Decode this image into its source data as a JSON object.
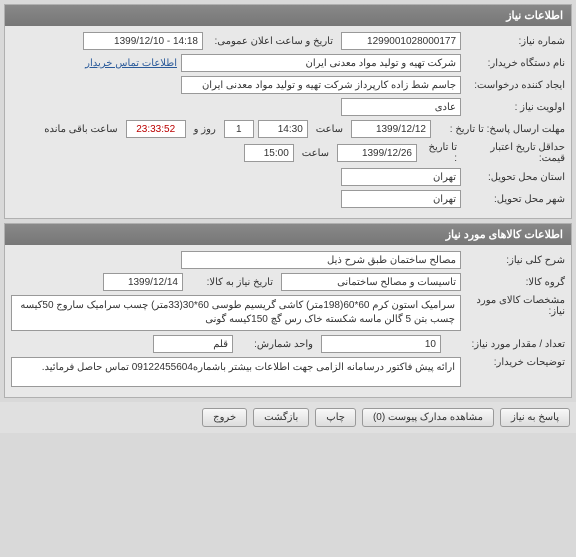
{
  "panel1": {
    "title": "اطلاعات نیاز",
    "need_no_label": "شماره نیاز:",
    "need_no": "1299001028000177",
    "announce_label": "تاریخ و ساعت اعلان عمومی:",
    "announce": "14:18 - 1399/12/10",
    "buyer_label": "نام دستگاه خریدار:",
    "buyer": "شرکت تهیه و تولید مواد معدنی ایران",
    "contact_link": "اطلاعات تماس خریدار",
    "requester_label": "ایجاد کننده درخواست:",
    "requester": "جاسم شط زاده کارپرداز شرکت تهیه و تولید مواد معدنی ایران",
    "priority_label": "اولویت نیاز :",
    "priority": "عادی",
    "deadline_label": "مهلت ارسال پاسخ:  تا تاریخ :",
    "deadline_date": "1399/12/12",
    "time_label": "ساعت",
    "deadline_time": "14:30",
    "days": "1",
    "days_label": "روز و",
    "countdown": "23:33:52",
    "remaining": "ساعت باقی مانده",
    "valid_label": "حداقل تاریخ اعتبار قیمت:",
    "to_date_label": "تا تاریخ :",
    "valid_date": "1399/12/26",
    "valid_time": "15:00",
    "province_label": "استان محل تحویل:",
    "province": "تهران",
    "city_label": "شهر محل تحویل:",
    "city": "تهران"
  },
  "panel2": {
    "title": "اطلاعات کالاهای مورد نیاز",
    "desc_label": "شرح کلی نیاز:",
    "desc": "مصالح ساختمان طبق شرح ذیل",
    "group_label": "گروه کالا:",
    "group": "تاسیسات و مصالح ساختمانی",
    "need_date_label": "تاریخ نیاز به کالا:",
    "need_date": "1399/12/14",
    "spec_label": "مشخصات کالای مورد نیاز:",
    "spec": "سرامیک استون کرم 60*60(198متر) کاشی  گریسیم طوسی 60*30(33متر) چسب سرامیک ساروج 50کیسه\nچسب بتن 5 گالن ماسه شکسته خاک رس گچ 150کیسه گونی",
    "qty_label": "تعداد / مقدار مورد نیاز:",
    "qty": "10",
    "unit_label": "واحد شمارش:",
    "unit": "قلم",
    "note_label": "توضیحات خریدار:",
    "note": "ارائه پیش فاکتور درسامانه الزامی جهت اطلاعات بیشتر باشماره09122455604 تماس حاصل فرمائید."
  },
  "buttons": {
    "reply": "پاسخ به نیاز",
    "attach": "مشاهده مدارک پیوست (0)",
    "print": "چاپ",
    "back": "بازگشت",
    "exit": "خروج"
  }
}
